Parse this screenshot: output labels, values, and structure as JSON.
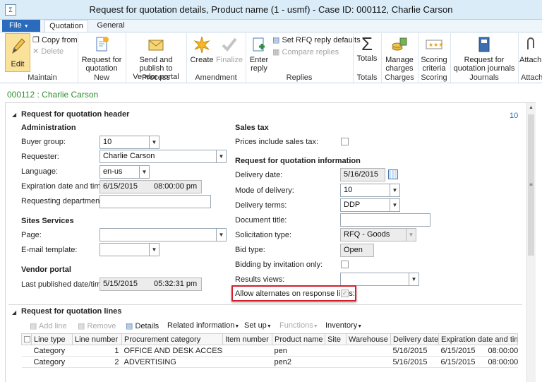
{
  "window": {
    "title": "Request for quotation details, Product name (1 - usmf) - Case ID: 000112, Charlie Carson"
  },
  "ribbon": {
    "file_tab": "File",
    "tabs": [
      "Quotation",
      "General"
    ],
    "edit": "Edit",
    "copy_from": "Copy from",
    "delete": "Delete",
    "request_for_quotation": "Request for quotation",
    "send_publish": "Send and publish to Vendor portal",
    "create": "Create",
    "finalize": "Finalize",
    "enter_reply": "Enter reply",
    "set_rfq_defaults": "Set RFQ reply defaults",
    "compare_replies": "Compare replies",
    "totals": "Totals",
    "manage_charges": "Manage charges",
    "scoring_criteria": "Scoring criteria",
    "rfq_journals": "Request for quotation journals",
    "attach": "Attach",
    "groups": [
      "Maintain",
      "New",
      "Process",
      "Amendment",
      "Replies",
      "Totals",
      "Charges",
      "Scoring",
      "Journals",
      "Attach"
    ]
  },
  "record_title": "000112 : Charlie Carson",
  "header_section": {
    "title": "Request for quotation header",
    "right_value": "10",
    "administration": {
      "heading": "Administration",
      "buyer_group_label": "Buyer group:",
      "buyer_group": "10",
      "requester_label": "Requester:",
      "requester": "Charlie Carson",
      "language_label": "Language:",
      "language": "en-us",
      "expiration_label": "Expiration date and time:",
      "expiration_date": "6/15/2015",
      "expiration_time": "08:00:00 pm",
      "requesting_dept_label": "Requesting department:",
      "requesting_dept": ""
    },
    "sites_services": {
      "heading": "Sites Services",
      "page_label": "Page:",
      "page": "",
      "email_template_label": "E-mail template:",
      "email_template": ""
    },
    "vendor_portal": {
      "heading": "Vendor portal",
      "last_published_label": "Last published date/time:",
      "last_published_date": "5/15/2015",
      "last_published_time": "05:32:31 pm"
    },
    "sales_tax": {
      "heading": "Sales tax",
      "prices_include_label": "Prices include sales tax:"
    },
    "rfq_information": {
      "heading": "Request for quotation information",
      "delivery_date_label": "Delivery date:",
      "delivery_date": "5/16/2015",
      "mode_label": "Mode of delivery:",
      "mode": "10",
      "terms_label": "Delivery terms:",
      "terms": "DDP",
      "doc_title_label": "Document title:",
      "doc_title": "",
      "solicitation_label": "Solicitation type:",
      "solicitation": "RFQ - Goods",
      "bid_type_label": "Bid type:",
      "bid_type": "Open",
      "bidding_label": "Bidding by invitation only:",
      "results_label": "Results views:",
      "results": "",
      "allow_alternates_label": "Allow alternates on response lines:"
    }
  },
  "lines_section": {
    "title": "Request for quotation lines",
    "toolbar": {
      "add_line": "Add line",
      "remove": "Remove",
      "details": "Details",
      "related": "Related information",
      "setup": "Set up",
      "functions": "Functions",
      "inventory": "Inventory"
    },
    "columns": [
      "Line type",
      "Line number",
      "Procurement category",
      "Item number",
      "Product name",
      "Site",
      "Warehouse",
      "Delivery date",
      "Expiration date and time"
    ],
    "rows": [
      {
        "line_type": "Category",
        "line_number": "1",
        "category": "OFFICE AND DESK ACCESS...",
        "item": "",
        "product": "pen",
        "site": "",
        "warehouse": "",
        "delivery": "5/16/2015",
        "exp_date": "6/15/2015",
        "exp_time": "08:00:00"
      },
      {
        "line_type": "Category",
        "line_number": "2",
        "category": "ADVERTISING",
        "item": "",
        "product": "pen2",
        "site": "",
        "warehouse": "",
        "delivery": "5/16/2015",
        "exp_date": "6/15/2015",
        "exp_time": "08:00:00"
      }
    ]
  }
}
